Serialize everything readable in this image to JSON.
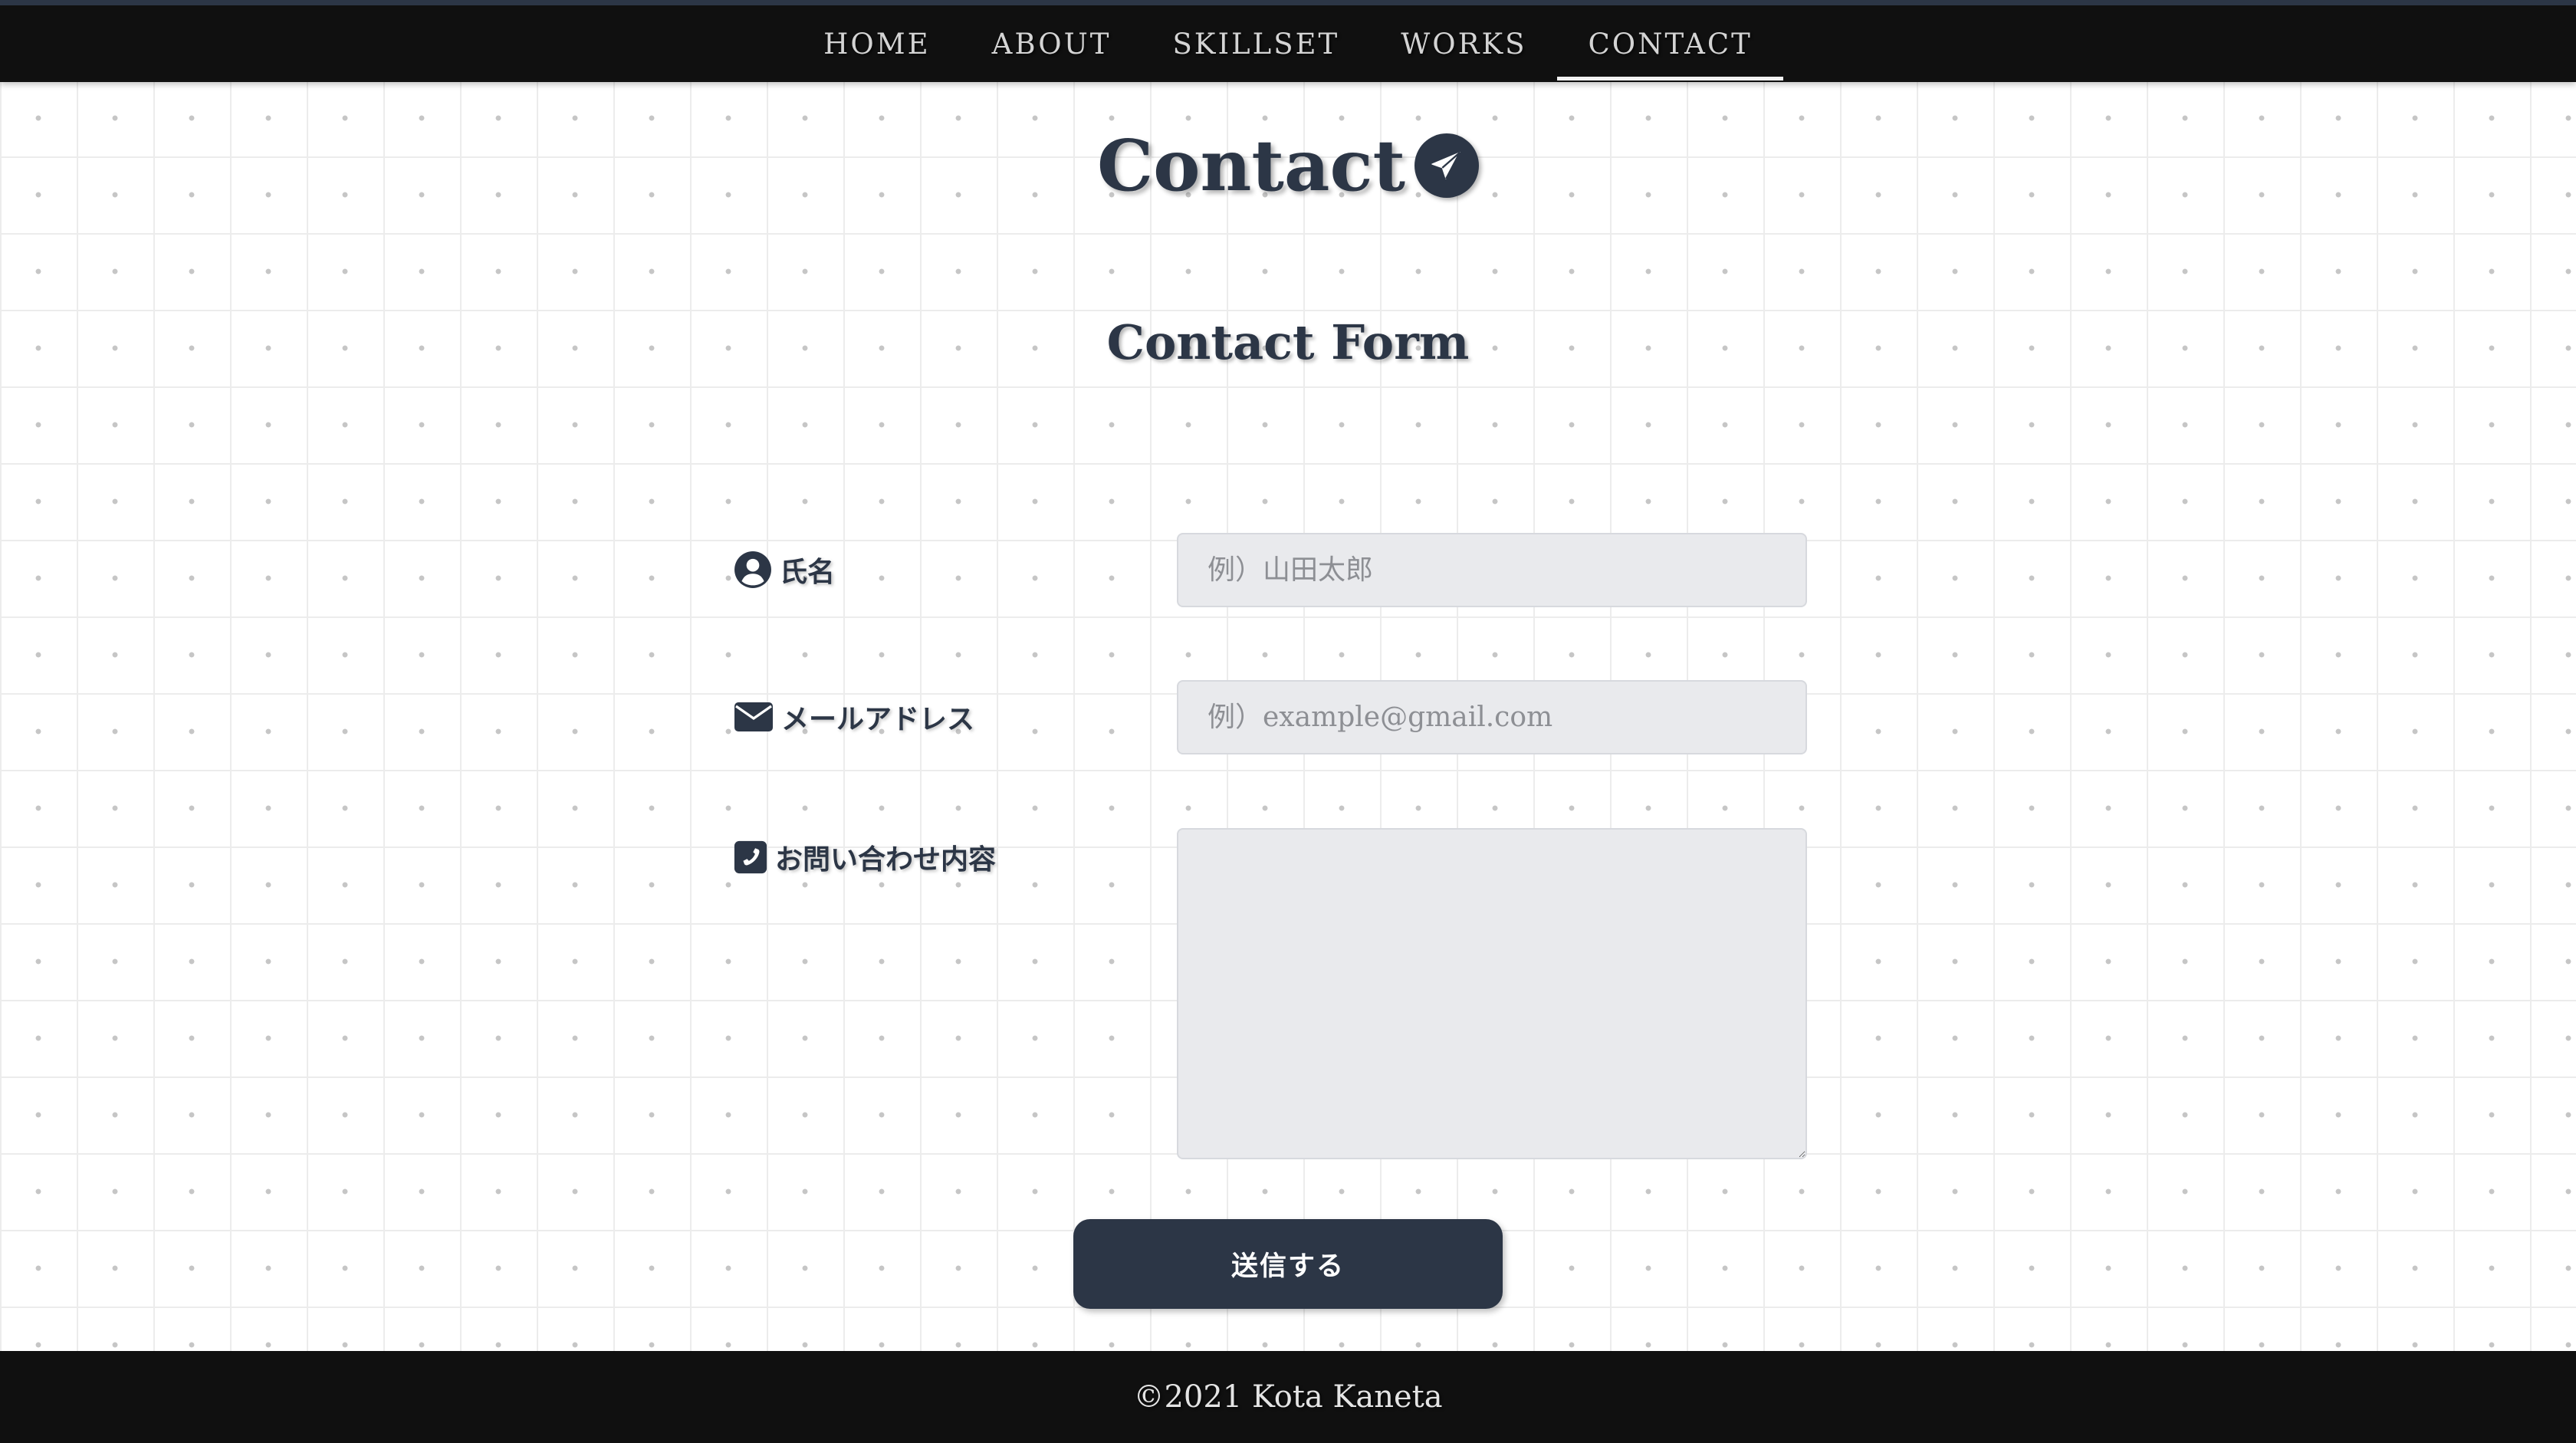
{
  "nav": {
    "items": [
      {
        "label": "HOME"
      },
      {
        "label": "ABOUT"
      },
      {
        "label": "SKILLSET"
      },
      {
        "label": "WORKS"
      },
      {
        "label": "CONTACT"
      }
    ],
    "active": "CONTACT"
  },
  "page": {
    "title": "Contact",
    "title_icon": "paper-plane-icon",
    "section_title": "Contact Form"
  },
  "form": {
    "name": {
      "label": "氏名",
      "icon": "user-circle-icon",
      "placeholder": "例）山田太郎",
      "value": ""
    },
    "email": {
      "label": "メールアドレス",
      "icon": "envelope-icon",
      "placeholder": "例）example@gmail.com",
      "value": ""
    },
    "message": {
      "label": "お問い合わせ内容",
      "icon": "phone-square-icon",
      "placeholder": "",
      "value": ""
    },
    "submit_label": "送信する"
  },
  "footer": {
    "copyright": "©2021 Kota Kaneta"
  },
  "colors": {
    "primary": "#2c3646",
    "nav_bg": "#101010",
    "field_bg": "#e9eaed"
  }
}
